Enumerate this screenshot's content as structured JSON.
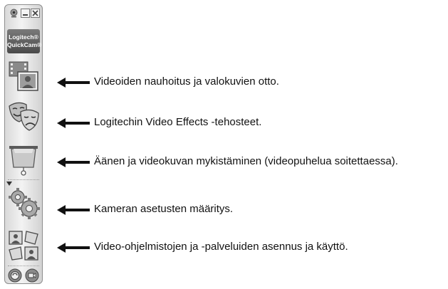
{
  "app": {
    "logo_line1": "Logitech®",
    "logo_line2": "QuickCam®"
  },
  "tools": [
    {
      "icon": "video-camera-photo-icon",
      "label": "Videoiden nauhoitus ja valokuvien otto."
    },
    {
      "icon": "theater-masks-icon",
      "label": "Logitechin Video Effects -tehosteet."
    },
    {
      "icon": "privacy-shade-icon",
      "label": "Äänen ja videokuvan mykistäminen (videopuhelua soitettaessa)."
    },
    {
      "icon": "gears-icon",
      "label": "Kameran asetusten määritys."
    },
    {
      "icon": "applications-icon",
      "label": "Video-ohjelmistojen ja -palveluiden asennus ja käyttö."
    }
  ],
  "colors": {
    "toolbar": "#e6e6e6",
    "border": "#8e8e8e",
    "icon": "#6f6f6f",
    "text": "#111111"
  }
}
